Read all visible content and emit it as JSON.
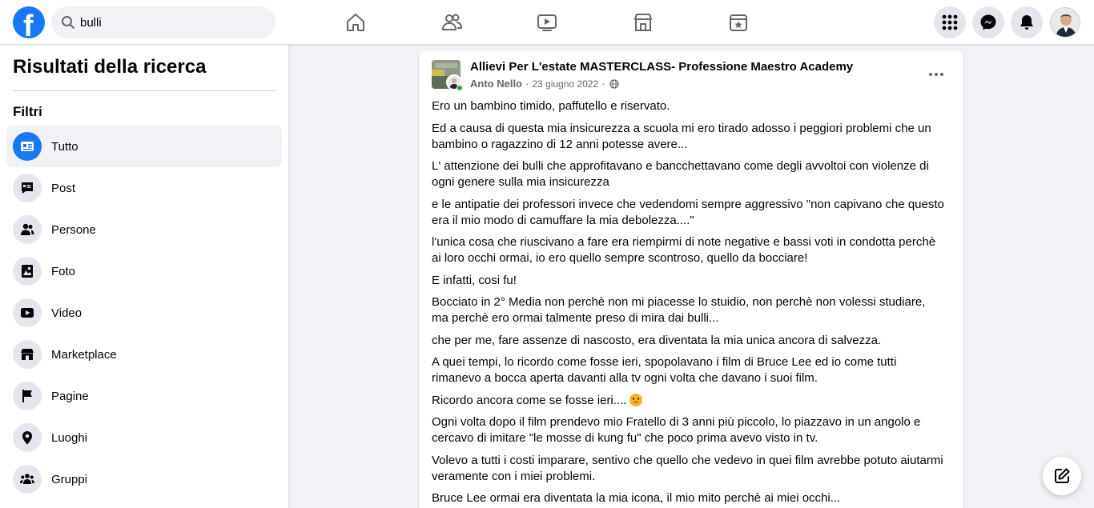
{
  "header": {
    "logo_letter": "f",
    "search_value": "bulli",
    "nav_tabs": [
      {
        "name": "home-icon"
      },
      {
        "name": "friends-icon"
      },
      {
        "name": "watch-icon"
      },
      {
        "name": "marketplace-icon"
      },
      {
        "name": "gaming-icon"
      }
    ],
    "right_buttons": [
      "menu-grid-icon",
      "messenger-icon",
      "notifications-icon",
      "profile-avatar"
    ]
  },
  "sidebar": {
    "title": "Risultati della ricerca",
    "filters_title": "Filtri",
    "items": [
      {
        "label": "Tutto",
        "icon": "all-results-icon",
        "active": true
      },
      {
        "label": "Post",
        "icon": "post-icon"
      },
      {
        "label": "Persone",
        "icon": "people-icon"
      },
      {
        "label": "Foto",
        "icon": "photo-icon"
      },
      {
        "label": "Video",
        "icon": "video-icon"
      },
      {
        "label": "Marketplace",
        "icon": "marketplace-icon"
      },
      {
        "label": "Pagine",
        "icon": "flag-icon"
      },
      {
        "label": "Luoghi",
        "icon": "location-icon"
      },
      {
        "label": "Gruppi",
        "icon": "groups-icon"
      }
    ]
  },
  "post": {
    "page_name": "Allievi Per L'estate MASTERCLASS- Professione Maestro Academy",
    "author": "Anto Nello",
    "separator": "·",
    "date": "23 giugno 2022",
    "privacy_icon": "globe-icon",
    "paragraphs": [
      "Ero un bambino timido, paffutello e riservato.",
      "Ed a causa di questa mia insicurezza a scuola mi ero tirado adosso i peggiori problemi che un bambino o ragazzino di 12 anni potesse avere...",
      "L' attenzione dei bulli che approfitavano e bancchettavano come degli avvoltoi con violenze di ogni genere sulla mia insicurezza",
      "e le antipatie dei professori invece che vedendomi sempre aggressivo \"non capivano che questo era il mio modo di camuffare la mia debolezza....\"",
      "l'unica cosa che riuscivano a fare era riempirmi di note negative e bassi voti in condotta perchè ai loro occhi ormai, io ero quello sempre scontroso, quello da bocciare!",
      "E infatti, cosi fu!",
      "Bocciato in 2° Media non perchè non mi piacesse lo stuidio, non perchè non volessi studiare, ma perchè ero ormai talmente preso di mira dai bulli...",
      "che per me, fare assenze di nascosto, era diventata la mia unica ancora di salvezza.",
      "A quei tempi, lo ricordo come fosse ieri, spopolavano i film di Bruce Lee ed io come tutti rimanevo a bocca aperta davanti alla tv ogni volta che davano i suoi film.",
      "Ricordo ancora come se fosse ieri....",
      "Ogni volta dopo il film  prendevo mio Fratello di 3 anni più piccolo, lo piazzavo in un angolo e cercavo di imitare \"le mosse di kung fu\" che poco prima avevo visto in tv.",
      "Volevo a tutti i costi imparare, sentivo che quello che vedevo in quei film avrebbe potuto aiutarmi veramente con i miei problemi.",
      "Bruce Lee ormai era diventata la mia icona, il mio mito perchè ai miei occhi..."
    ]
  },
  "colors": {
    "brand": "#1877f2",
    "background": "#f0f2f5",
    "online": "#31a24c"
  }
}
